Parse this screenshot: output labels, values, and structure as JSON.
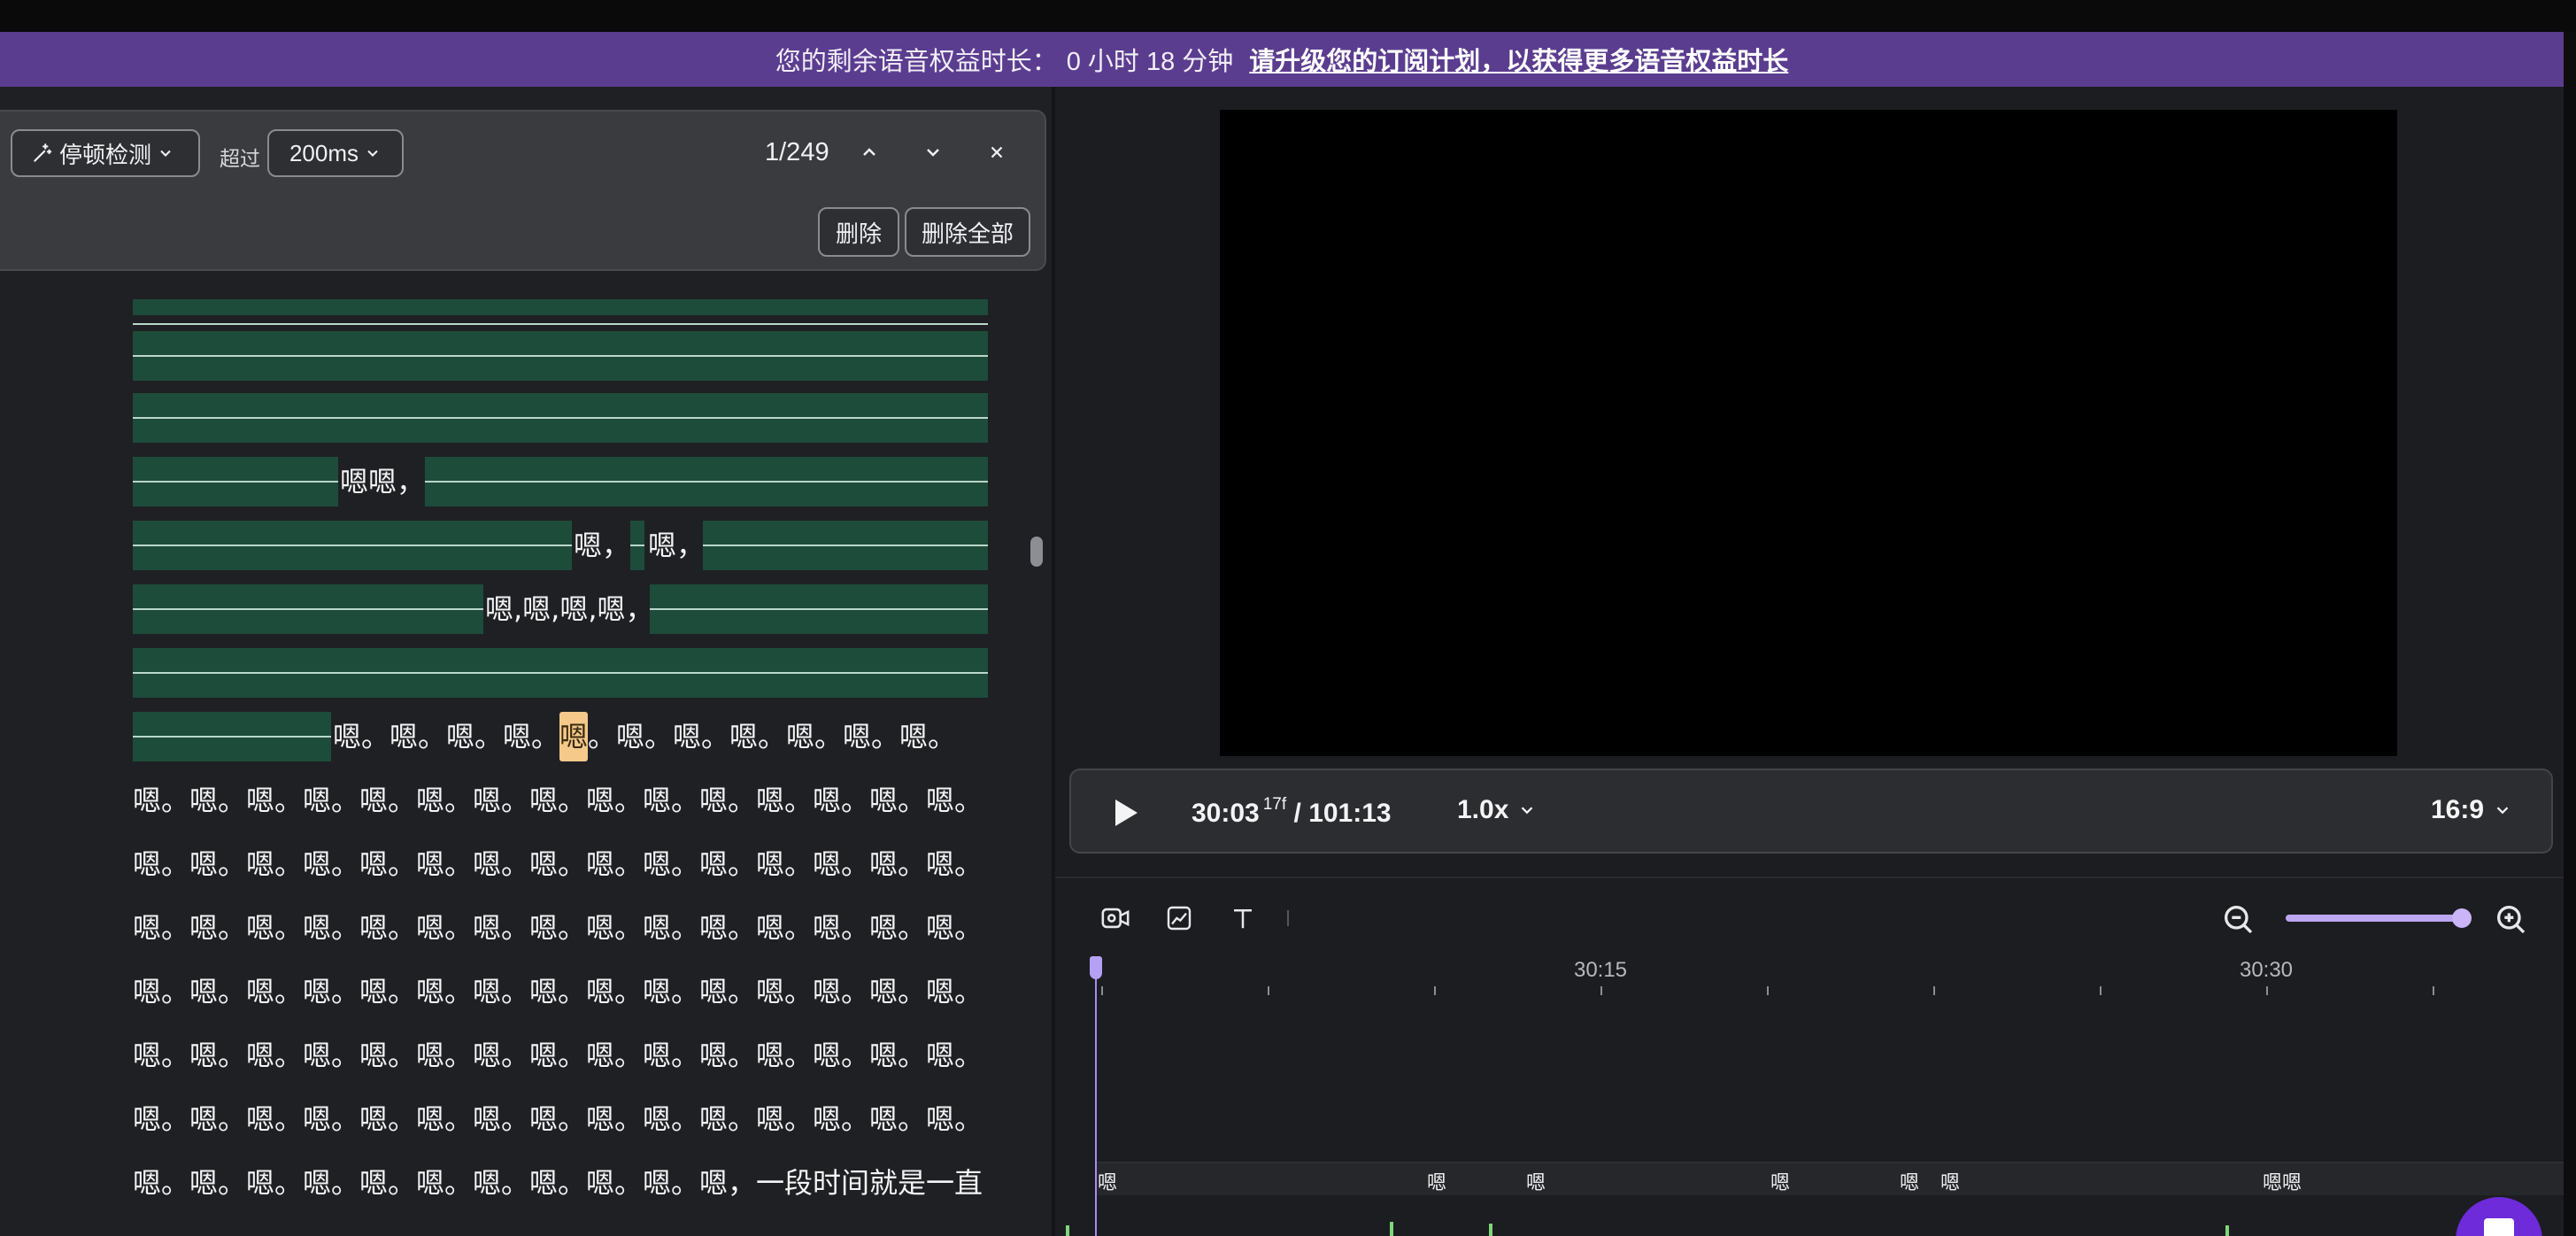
{
  "banner": {
    "text": "您的剩余语音权益时长：",
    "remaining": "0 小时 18 分钟",
    "upgrade_link": "请升级您的订阅计划，以获得更多语音权益时长",
    "bg_color": "#5b3d8f"
  },
  "toolbar": {
    "pause_detect_label": "停顿检测",
    "over_label": "超过",
    "threshold_value": "200ms",
    "counter": "1/249",
    "delete_label": "删除",
    "delete_all_label": "删除全部",
    "icons": [
      "sparkle-icon",
      "chevron-up-icon",
      "chevron-down-icon",
      "close-icon"
    ]
  },
  "transcript": {
    "lines": [
      {
        "texts": []
      },
      {
        "texts": []
      },
      {
        "texts": []
      },
      {
        "texts": [
          "嗯嗯，"
        ]
      },
      {
        "texts": [
          "嗯，",
          "嗯，"
        ]
      },
      {
        "texts": [
          "嗯,嗯,嗯,嗯，"
        ]
      },
      {
        "texts": []
      },
      {
        "texts": [
          "嗯。嗯。嗯。嗯。",
          "嗯",
          "。嗯。嗯。嗯。嗯。嗯。嗯。"
        ]
      },
      {
        "texts": [
          "嗯。嗯。嗯。嗯。嗯。嗯。嗯。嗯。嗯。嗯。嗯。嗯。嗯。嗯。嗯。"
        ]
      },
      {
        "texts": [
          "嗯。嗯。嗯。嗯。嗯。嗯。嗯。嗯。嗯。嗯。嗯。嗯。嗯。嗯。嗯。"
        ]
      },
      {
        "texts": [
          "嗯。嗯。嗯。嗯。嗯。嗯。嗯。嗯。嗯。嗯。嗯。嗯。嗯。嗯。嗯。"
        ]
      },
      {
        "texts": [
          "嗯。嗯。嗯。嗯。嗯。嗯。嗯。嗯。嗯。嗯。嗯。嗯。嗯。嗯。嗯。"
        ]
      },
      {
        "texts": [
          "嗯。嗯。嗯。嗯。嗯。嗯。嗯。嗯。嗯。嗯。嗯。嗯。嗯。嗯。嗯。"
        ]
      },
      {
        "texts": [
          "嗯。嗯。嗯。嗯。嗯。嗯。嗯。嗯。嗯。嗯。嗯。嗯。嗯。嗯。嗯。"
        ]
      },
      {
        "texts": [
          "嗯。嗯。嗯。嗯。嗯。嗯。嗯。嗯。嗯。嗯。嗯，一段时间就是一直"
        ]
      }
    ],
    "pause_color": "#1e4c3a",
    "highlight_color": "#f4c98a"
  },
  "player": {
    "current_time": "30:03",
    "frame": "17f",
    "separator": "/",
    "total_time": "101:13",
    "speed": "1.0x",
    "aspect_ratio": "16:9"
  },
  "timeline": {
    "tools": [
      "video-add-icon",
      "chart-icon",
      "text-icon"
    ],
    "ticks": [
      "30:15",
      "30:30"
    ],
    "chips": [
      "嗯",
      "嗯",
      "嗯",
      "嗯",
      "嗯",
      "嗯",
      "嗯嗯"
    ],
    "accent_color": "#a48df0"
  }
}
